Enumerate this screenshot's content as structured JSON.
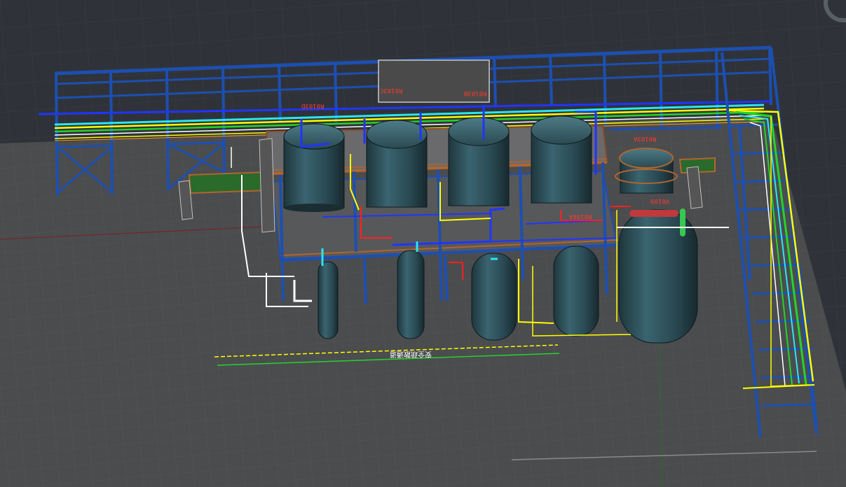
{
  "equipment_labels": {
    "r0103d": "R0103D",
    "r0103c": "R0103C",
    "r0103b": "R0103B",
    "r0103a": "R0103A",
    "v0109": "V0109",
    "r0104a": "R0104A"
  },
  "ground_sign": "安全疏散通道",
  "colors": {
    "background": "#2f3339",
    "ground": "#4b4c4e",
    "steel_frame": "#1d4fb0",
    "tank_body": "#2b4850",
    "pipe_yellow": "#ffff00",
    "pipe_green": "#25d32a",
    "pipe_cyan": "#29e7f0",
    "pipe_white": "#ffffff",
    "pipe_red": "#ff2020",
    "platform_rail": "#b0652f",
    "label_red": "#ff3b2f"
  },
  "icons": {
    "viewcube": "viewcube-ring-icon"
  }
}
